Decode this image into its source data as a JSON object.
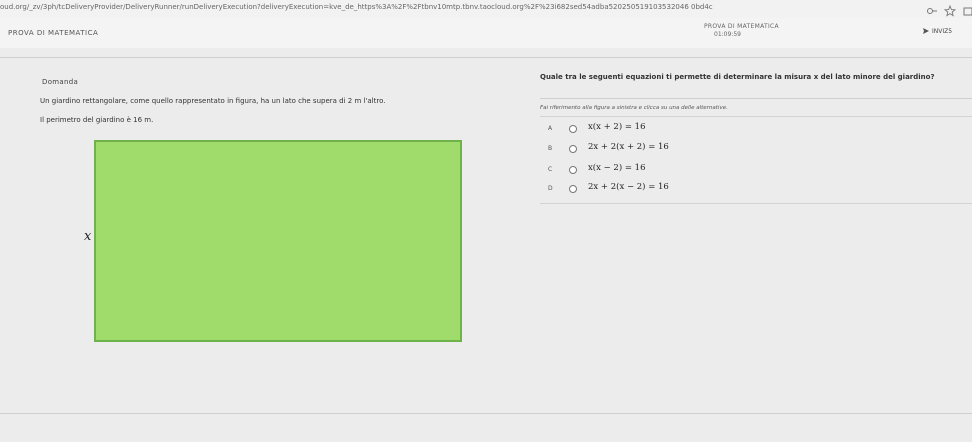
{
  "browser": {
    "url": "oud.org/_zv/3ph/tcDeliveryProvider/DeliveryRunner/runDeliveryExecution?deliveryExecution=kve_de_https%3A%2F%2Ftbnv10mtp.tbnv.taocloud.org%2F%23i682sed54adba520250519103532046 0bd4c"
  },
  "header": {
    "app_title": "PROVA DI MATEMATICA",
    "test_name": "PROVA DI MATEMATICA",
    "timer": "01:09:59",
    "submit_label": "INVIZ5"
  },
  "question": {
    "label": "Domanda",
    "stem_line1": "Un giardino rettangolare, come quello rappresentato in figura, ha un lato che supera di 2 m l'altro.",
    "stem_line2": "Il perimetro del giardino è 16 m.",
    "figure_variable": "x",
    "title": "Quale tra le seguenti equazioni ti permette di determinare la misura x del lato minore del giardino?",
    "instruction": "Fai riferimento alla figura a sinistra e clicca su una delle alternative.",
    "answers": [
      {
        "letter": "A",
        "formula": "x(x + 2) = 16"
      },
      {
        "letter": "B",
        "formula": "2x + 2(x + 2) = 16"
      },
      {
        "letter": "C",
        "formula": "x(x − 2) = 16"
      },
      {
        "letter": "D",
        "formula": "2x + 2(x − 2) = 16"
      }
    ]
  },
  "colors": {
    "rectangle_fill": "#9fdc6c",
    "rectangle_border": "#6fb24a"
  }
}
